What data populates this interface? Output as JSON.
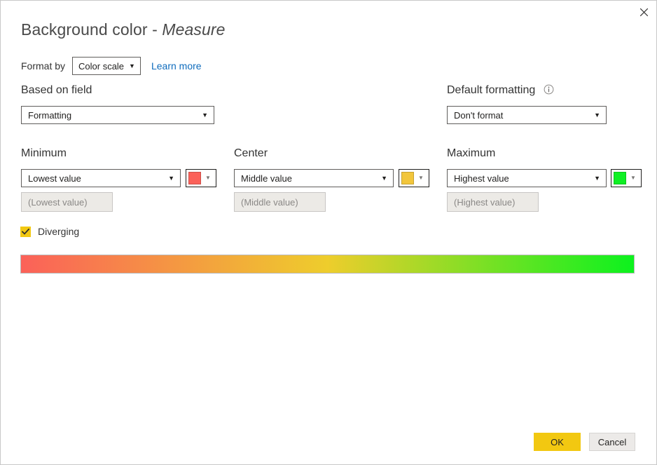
{
  "dialog": {
    "title_main": "Background color - ",
    "title_measure": "Measure",
    "close_icon": "close-icon"
  },
  "format_by": {
    "label": "Format by",
    "value": "Color scale",
    "caret": "▼",
    "learn_more": "Learn more"
  },
  "based_on_field": {
    "heading": "Based on field",
    "value": "Formatting",
    "caret": "▼"
  },
  "default_formatting": {
    "heading": "Default formatting",
    "info_icon": "info-icon",
    "value": "Don't format",
    "caret": "▼"
  },
  "stops": {
    "minimum": {
      "heading": "Minimum",
      "select_value": "Lowest value",
      "caret": "▼",
      "input_placeholder": "(Lowest value)",
      "color": "#FB6159",
      "picker_caret": "▼"
    },
    "center": {
      "heading": "Center",
      "select_value": "Middle value",
      "caret": "▼",
      "input_placeholder": "(Middle value)",
      "color": "#F2C63C",
      "picker_caret": "▼"
    },
    "maximum": {
      "heading": "Maximum",
      "select_value": "Highest value",
      "caret": "▼",
      "input_placeholder": "(Highest value)",
      "color": "#0FF024",
      "picker_caret": "▼"
    }
  },
  "diverging": {
    "label": "Diverging",
    "checked": true,
    "check_color": "#f2c811"
  },
  "gradient_preview": {
    "start_color": "#FB6159",
    "mid_color": "#EECD2C",
    "end_color": "#0CF21E"
  },
  "footer": {
    "ok_label": "OK",
    "cancel_label": "Cancel",
    "ok_color": "#f2c811",
    "cancel_color": "#eceae8"
  }
}
